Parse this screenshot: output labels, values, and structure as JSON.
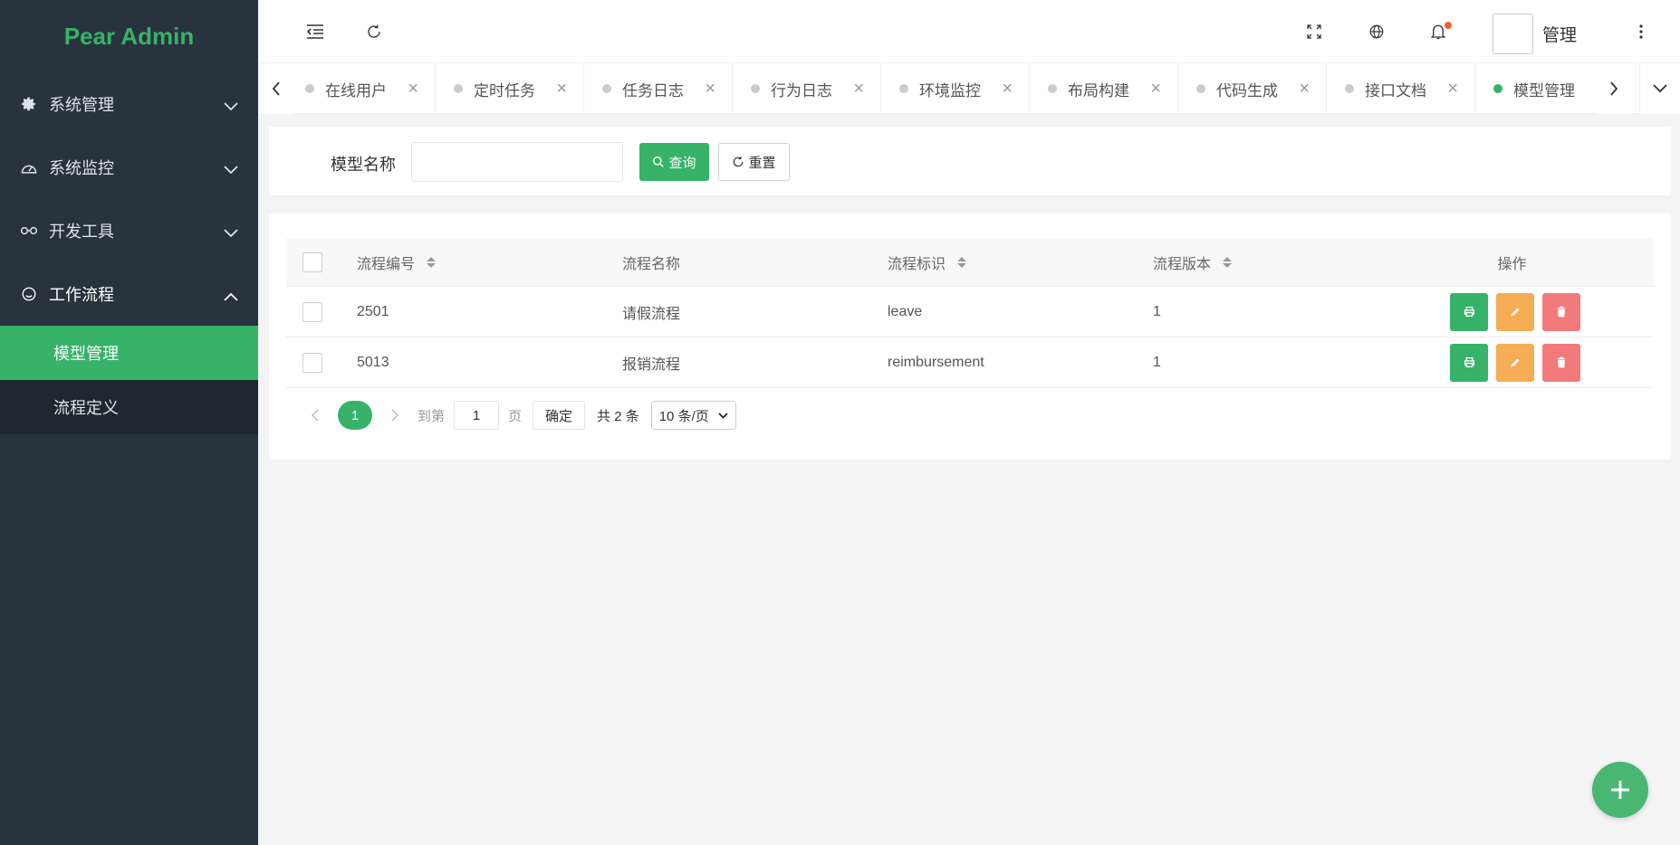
{
  "app": {
    "logo": "Pear Admin",
    "accent": "#36b368"
  },
  "sidebar": {
    "menus": [
      {
        "label": "系统管理",
        "icon": "gear-icon"
      },
      {
        "label": "系统监控",
        "icon": "gauge-icon"
      },
      {
        "label": "开发工具",
        "icon": "link-icon"
      },
      {
        "label": "工作流程",
        "icon": "smile-icon"
      }
    ],
    "submenu": [
      {
        "label": "模型管理",
        "active": true
      },
      {
        "label": "流程定义",
        "active": false
      }
    ]
  },
  "header": {
    "username": "管理"
  },
  "tabs": [
    {
      "label": "在线用户"
    },
    {
      "label": "定时任务"
    },
    {
      "label": "任务日志"
    },
    {
      "label": "行为日志"
    },
    {
      "label": "环境监控"
    },
    {
      "label": "布局构建"
    },
    {
      "label": "代码生成"
    },
    {
      "label": "接口文档"
    },
    {
      "label": "模型管理",
      "active": true
    }
  ],
  "search": {
    "label": "模型名称",
    "value": "",
    "placeholder": "",
    "query_label": "查询",
    "reset_label": "重置"
  },
  "table": {
    "columns": [
      "流程编号",
      "流程名称",
      "流程标识",
      "流程版本",
      "操作"
    ],
    "rows": [
      {
        "id": "2501",
        "name": "请假流程",
        "key": "leave",
        "version": "1"
      },
      {
        "id": "5013",
        "name": "报销流程",
        "key": "reimbursement",
        "version": "1"
      }
    ]
  },
  "pager": {
    "current": "1",
    "goto_prefix": "到第",
    "goto_value": "1",
    "goto_suffix": "页",
    "confirm": "确定",
    "total": "共 2 条",
    "page_size": "10 条/页"
  }
}
